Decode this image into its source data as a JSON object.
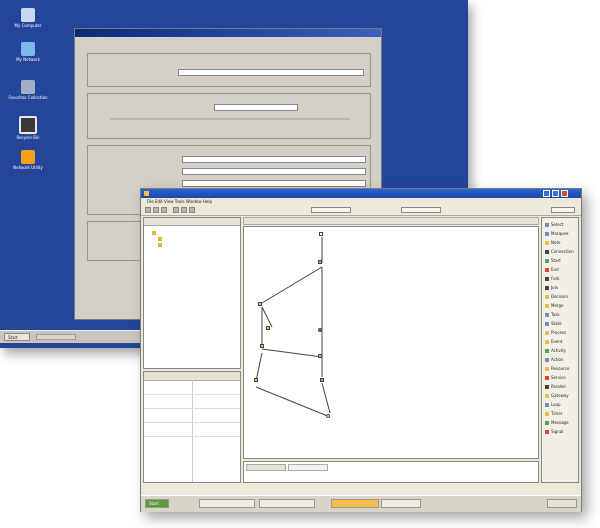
{
  "desktop": {
    "icons": [
      "My Computer",
      "My Network",
      "Favorites Collection",
      "Recycle Bin",
      "Network Utility"
    ]
  },
  "config_window": {
    "title": "",
    "tabs": "",
    "groups": [
      "",
      "",
      "",
      ""
    ],
    "fields": [
      {
        "label": "",
        "value": ""
      },
      {
        "label": "",
        "value": ""
      },
      {
        "label": "",
        "value": ""
      },
      {
        "label": "",
        "value": ""
      },
      {
        "label": "",
        "value": ""
      }
    ]
  },
  "taskbar1": {
    "start": "Start"
  },
  "editor": {
    "title": "",
    "menu": "File Edit View Tools Window Help",
    "tree": [
      "",
      "",
      ""
    ],
    "palette": [
      "Select",
      "Marquee",
      "Note",
      "Connection",
      "Start",
      "End",
      "Fork",
      "Join",
      "Decision",
      "Merge",
      "Task",
      "State",
      "Process",
      "Event",
      "Activity",
      "Action",
      "Resource",
      "Service",
      "Parallel",
      "Gateway",
      "Loop",
      "Timer",
      "Message",
      "Signal"
    ],
    "diagram_nodes": [
      "",
      "",
      "",
      "",
      "",
      "",
      "",
      "",
      "",
      "",
      "",
      "",
      ""
    ],
    "bottom_tabs": [
      "",
      ""
    ],
    "status": ""
  },
  "taskbar2": {
    "start": "Start",
    "buttons": [
      "",
      "",
      "",
      ""
    ],
    "clock": ""
  }
}
